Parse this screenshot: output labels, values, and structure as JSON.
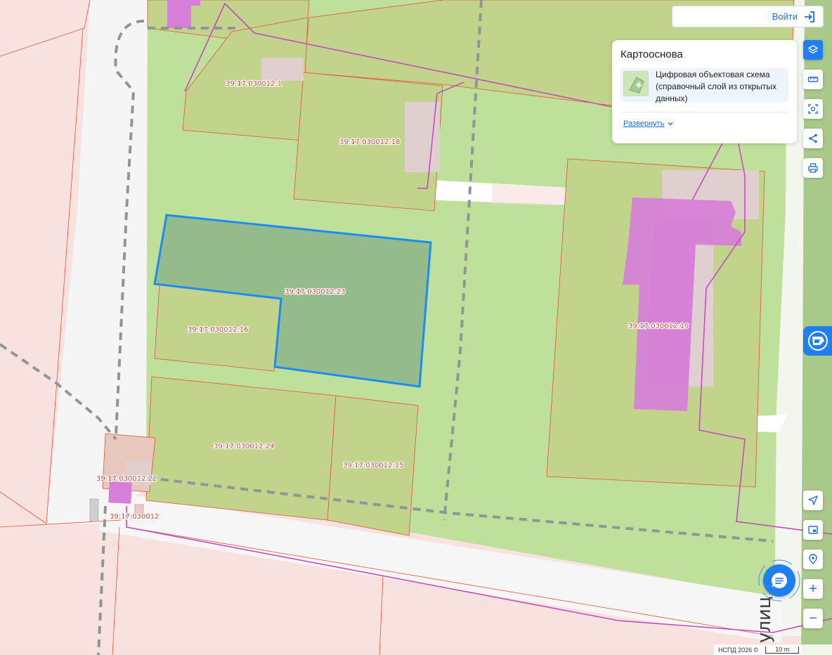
{
  "header": {
    "login_label": "Войти"
  },
  "layers_panel": {
    "title": "Картооснова",
    "active_layer": "Цифровая объектовая схема (справочный слой из открытых данных)",
    "expand_label": "Развернуть"
  },
  "map": {
    "parcels": [
      {
        "id": "39:17:030012:1"
      },
      {
        "id": "39:17:030012:18"
      },
      {
        "id": "39:17:030012:23",
        "selected": true
      },
      {
        "id": "39:17:030012:16"
      },
      {
        "id": "39:17:030012:19"
      },
      {
        "id": "39:17:030012:24"
      },
      {
        "id": "39:17:030012:15"
      },
      {
        "id": "39:17:030012:22"
      },
      {
        "id": "39:17:030012"
      }
    ],
    "street_label": "улиц",
    "colors": {
      "background": "#f7e2df",
      "green_zone": "#bfe09a",
      "parcel_fill": "#c2d38c",
      "parcel_border": "#e8503a",
      "selected_fill": "#95bb8c",
      "selected_border": "#1a8df2",
      "building": "#d77fd8",
      "road": "#ffffff",
      "boundary_line": "#c64bc0"
    }
  },
  "toolbar": {
    "layers_icon": "layers-icon",
    "ruler_icon": "ruler-icon",
    "select_area_icon": "select-area-icon",
    "share_icon": "share-icon",
    "print_icon": "print-icon",
    "locate_icon": "locate-arrow-icon",
    "minimap_icon": "minimap-icon",
    "geo_search_icon": "geo-search-icon",
    "zoom_in_label": "+",
    "zoom_out_label": "−"
  },
  "footer": {
    "attribution": "НСПД 2026 ©",
    "scale_label": "10 m"
  }
}
